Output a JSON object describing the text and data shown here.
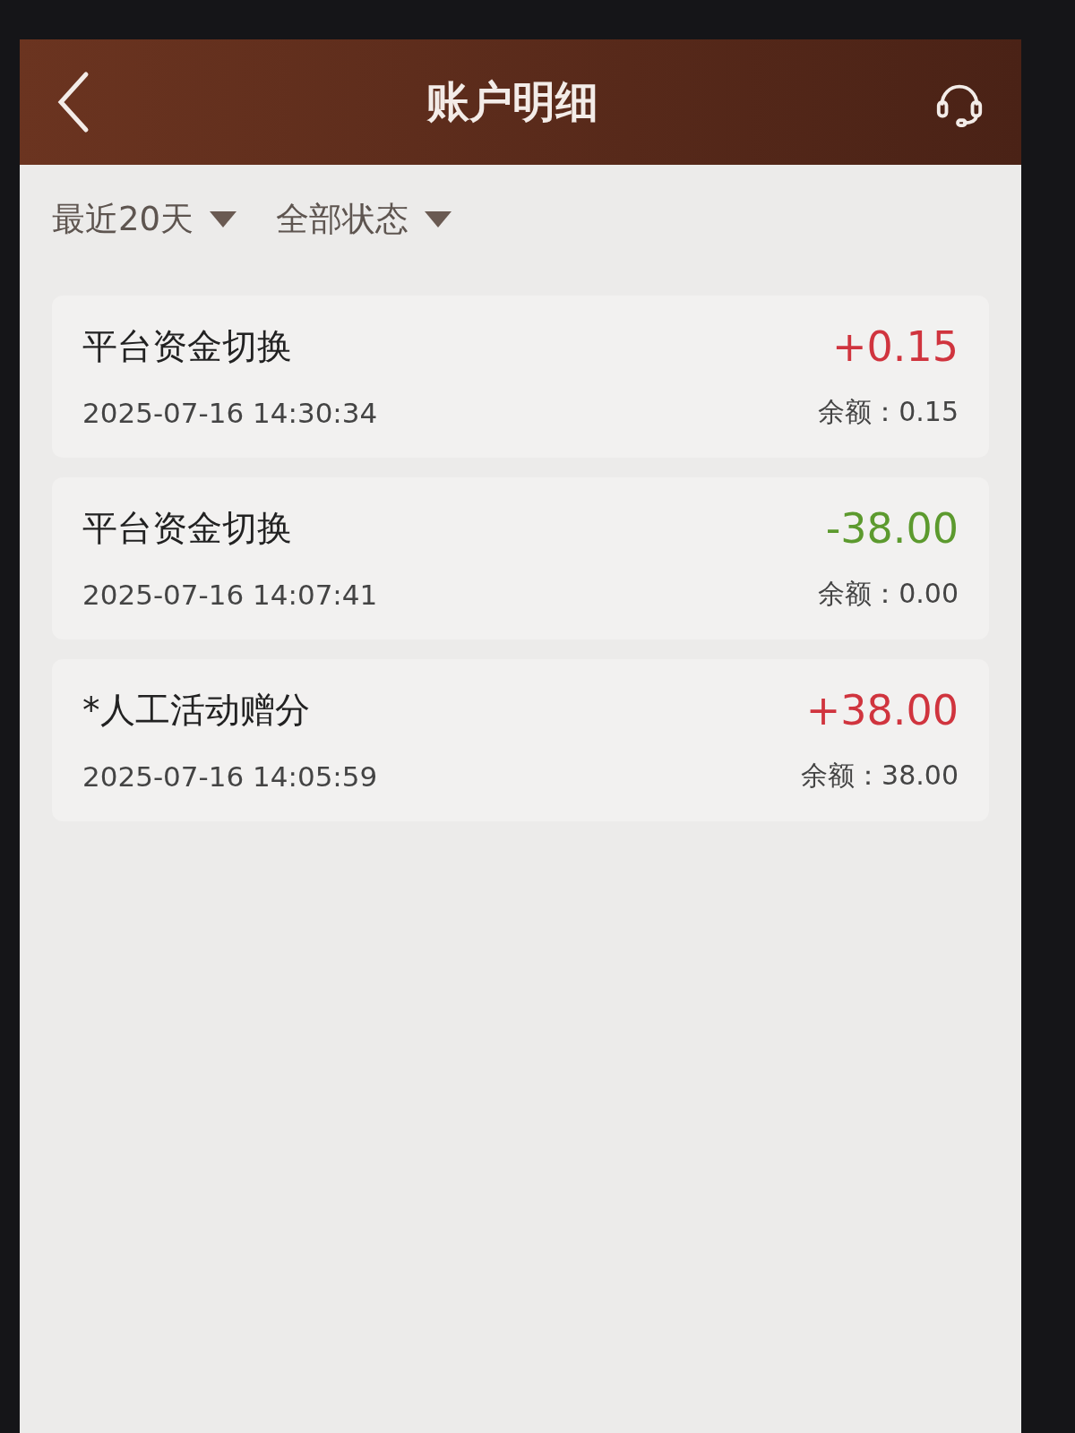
{
  "header": {
    "title": "账户明细"
  },
  "filters": [
    {
      "label": "最近20天"
    },
    {
      "label": "全部状态"
    }
  ],
  "records": [
    {
      "title": "平台资金切换",
      "time": "2025-07-16 14:30:34",
      "amount": "+0.15",
      "kind": "credit",
      "balance": "余额：0.15"
    },
    {
      "title": "平台资金切换",
      "time": "2025-07-16 14:07:41",
      "amount": "-38.00",
      "kind": "debit",
      "balance": "余额：0.00"
    },
    {
      "title": "*人工活动赠分",
      "time": "2025-07-16 14:05:59",
      "amount": "+38.00",
      "kind": "credit",
      "balance": "余额：38.00"
    }
  ]
}
